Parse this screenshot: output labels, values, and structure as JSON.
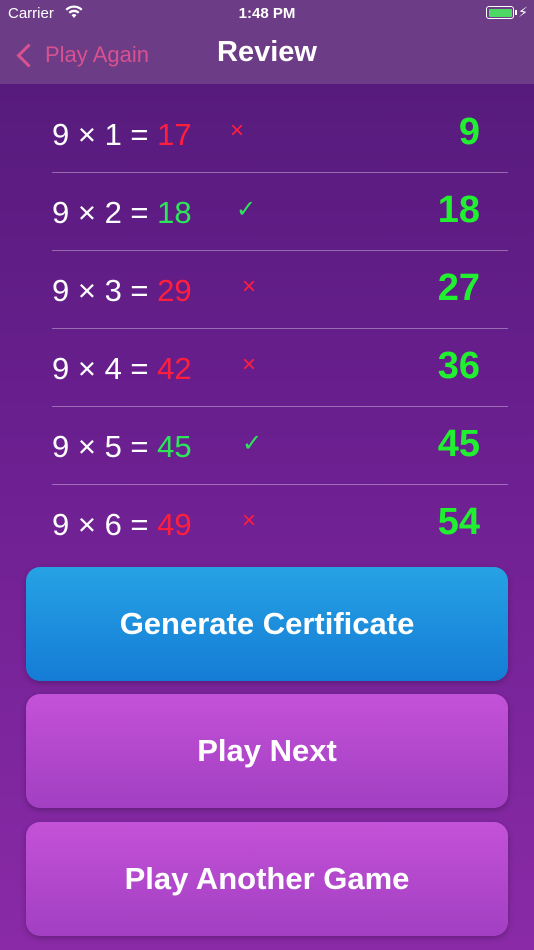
{
  "status_bar": {
    "carrier": "Carrier",
    "time": "1:48 PM"
  },
  "nav": {
    "back_label": "Play Again",
    "title": "Review"
  },
  "rows": [
    {
      "question": "9 × 1 = ",
      "answer": "17",
      "correct": false,
      "mark": "×",
      "correct_value": "9"
    },
    {
      "question": "9 × 2 = ",
      "answer": "18",
      "correct": true,
      "mark": "✓",
      "correct_value": "18"
    },
    {
      "question": "9 × 3 = ",
      "answer": "29",
      "correct": false,
      "mark": "×",
      "correct_value": "27"
    },
    {
      "question": "9 × 4 = ",
      "answer": "42",
      "correct": false,
      "mark": "×",
      "correct_value": "36"
    },
    {
      "question": "9 × 5 = ",
      "answer": "45",
      "correct": true,
      "mark": "✓",
      "correct_value": "45"
    },
    {
      "question": "9 × 6 = ",
      "answer": "49",
      "correct": false,
      "mark": "×",
      "correct_value": "54"
    }
  ],
  "buttons": {
    "generate_certificate": "Generate Certificate",
    "play_next": "Play Next",
    "play_another_game": "Play Another Game"
  },
  "colors": {
    "correct": "#2ce65a",
    "wrong": "#ff1e3c",
    "correct_value": "#20f02f",
    "back": "#d9518f"
  }
}
